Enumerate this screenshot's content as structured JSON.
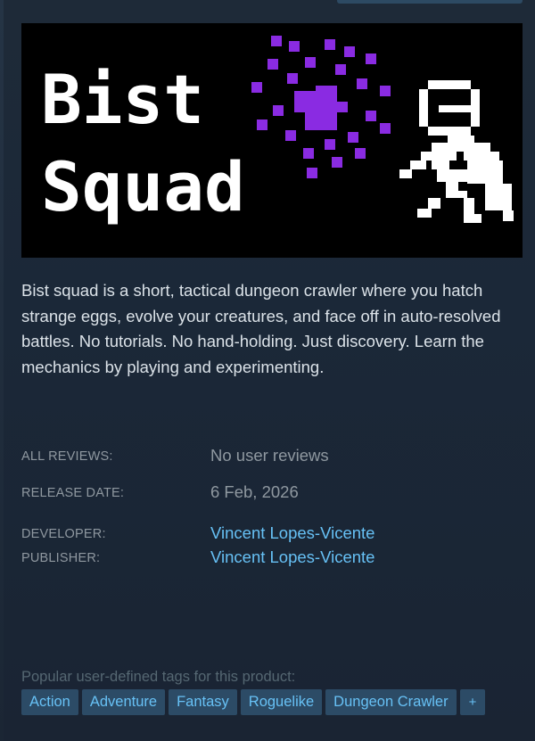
{
  "capsule": {
    "title_line1": "Bist",
    "title_line2": "Squad"
  },
  "description": "Bist squad is a short, tactical dungeon crawler where you hatch strange eggs, evolve your creatures, and face off in auto-resolved battles. No tutorials. No hand-holding. Just discovery. Learn the mechanics by playing and experimenting.",
  "info": {
    "reviews_label": "ALL REVIEWS:",
    "reviews_value": "No user reviews",
    "release_label": "RELEASE DATE:",
    "release_value": "6 Feb, 2026",
    "developer_label": "DEVELOPER:",
    "developer_value": "Vincent Lopes-Vicente",
    "publisher_label": "PUBLISHER:",
    "publisher_value": "Vincent Lopes-Vicente"
  },
  "tags": {
    "header": "Popular user-defined tags for this product:",
    "items": [
      "Action",
      "Adventure",
      "Fantasy",
      "Roguelike",
      "Dungeon Crawler"
    ],
    "more_label": "+"
  },
  "colors": {
    "background": "#1b2838",
    "link": "#66c0f4",
    "tag_bg": "#2c4b66",
    "muted": "#8f98a0",
    "creature_purple": "#8a2be2"
  }
}
